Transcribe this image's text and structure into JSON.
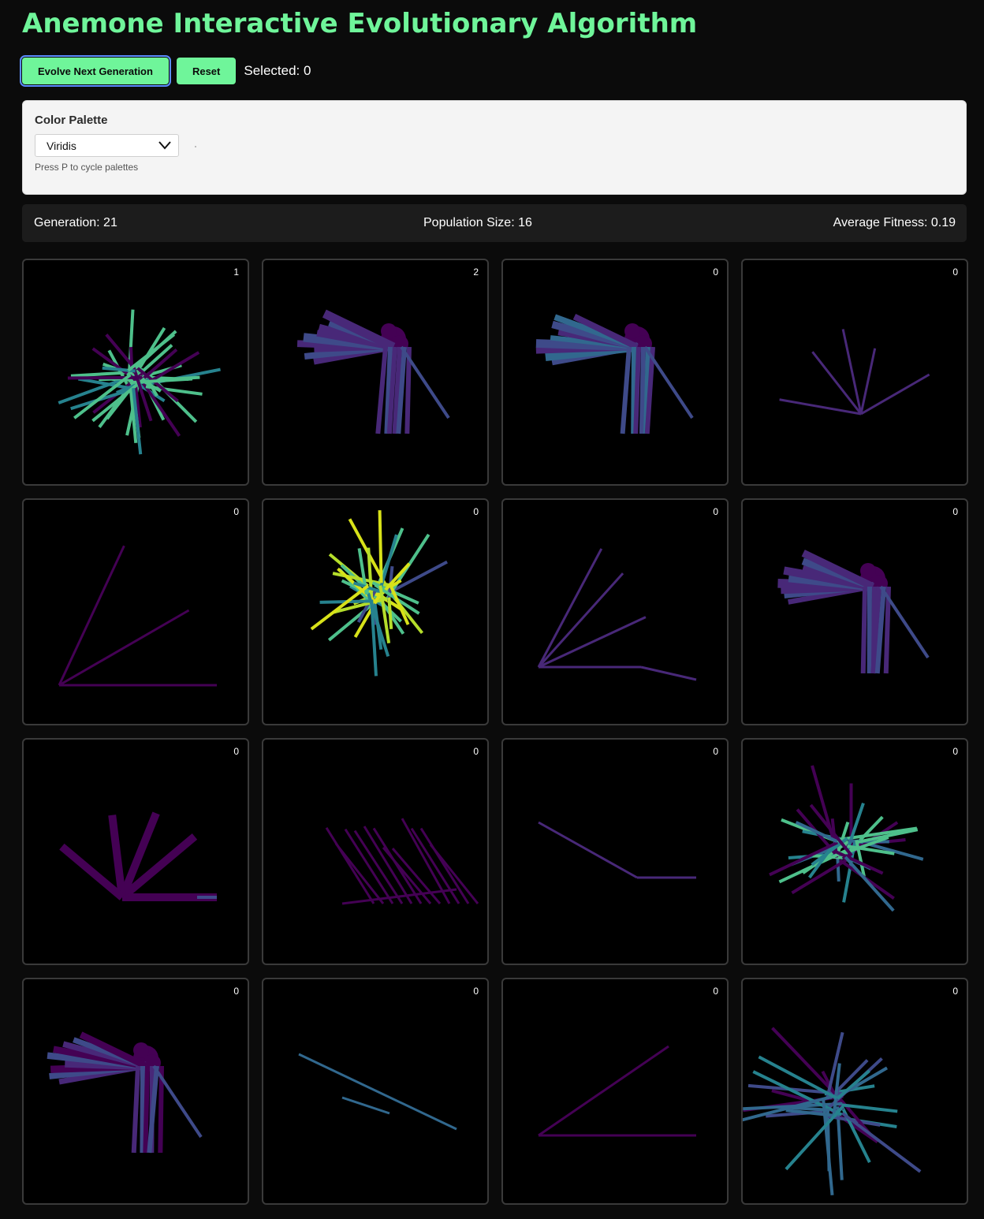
{
  "app": {
    "title": "Anemone Interactive Evolutionary Algorithm"
  },
  "toolbar": {
    "evolve_label": "Evolve Next Generation",
    "reset_label": "Reset",
    "selected_text": "Selected: 0"
  },
  "palette": {
    "label": "Color Palette",
    "selected_value": "Viridis",
    "hint": "Press P to cycle palettes"
  },
  "stats": {
    "generation": "Generation: 21",
    "population": "Population Size: 16",
    "fitness": "Average Fitness: 0.19"
  },
  "colors": {
    "accent": "#6ff59a",
    "viridis_dark": "#440154",
    "viridis_purple": "#482878",
    "viridis_indigo": "#3e4a89",
    "viridis_blue": "#31688e",
    "viridis_teal": "#26828e",
    "viridis_green": "#35b779",
    "viridis_sea": "#4ec08b",
    "viridis_lime": "#b5de2b",
    "viridis_yellow": "#d8e219"
  },
  "population": [
    {
      "fitness": "1"
    },
    {
      "fitness": "2"
    },
    {
      "fitness": "0"
    },
    {
      "fitness": "0"
    },
    {
      "fitness": "0"
    },
    {
      "fitness": "0"
    },
    {
      "fitness": "0"
    },
    {
      "fitness": "0"
    },
    {
      "fitness": "0"
    },
    {
      "fitness": "0"
    },
    {
      "fitness": "0"
    },
    {
      "fitness": "0"
    },
    {
      "fitness": "0"
    },
    {
      "fitness": "0"
    },
    {
      "fitness": "0"
    },
    {
      "fitness": "0"
    }
  ]
}
